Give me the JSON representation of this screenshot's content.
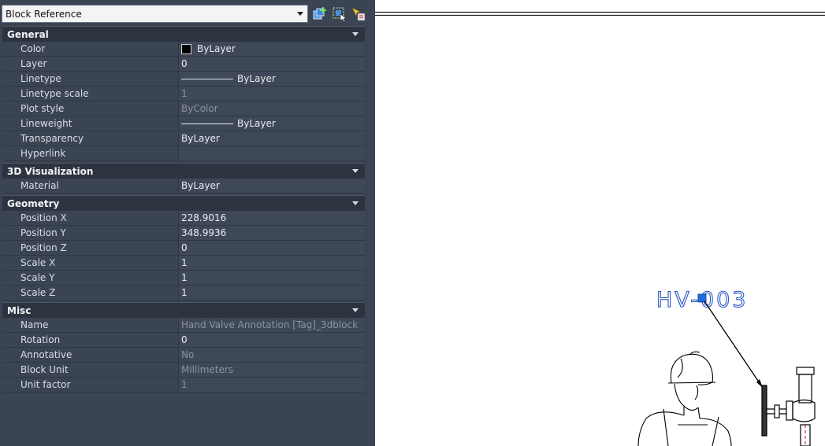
{
  "palette": {
    "selected_object": "Block Reference",
    "icons": {
      "toggle_pickadd": "toggle-pickadd-icon",
      "select_objects": "select-objects-icon",
      "quick_select": "quick-select-icon"
    },
    "categories": [
      {
        "title": "General",
        "rows": [
          {
            "name": "Color",
            "value": "ByLayer",
            "kind": "color",
            "readonly": false
          },
          {
            "name": "Layer",
            "value": "0",
            "kind": "text",
            "readonly": false
          },
          {
            "name": "Linetype",
            "value": "ByLayer",
            "kind": "line",
            "readonly": false
          },
          {
            "name": "Linetype scale",
            "value": "1",
            "kind": "text",
            "readonly": true
          },
          {
            "name": "Plot style",
            "value": "ByColor",
            "kind": "text",
            "readonly": true
          },
          {
            "name": "Lineweight",
            "value": "ByLayer",
            "kind": "line",
            "readonly": false
          },
          {
            "name": "Transparency",
            "value": "ByLayer",
            "kind": "text",
            "readonly": false
          },
          {
            "name": "Hyperlink",
            "value": "",
            "kind": "text",
            "readonly": false
          }
        ]
      },
      {
        "title": "3D Visualization",
        "rows": [
          {
            "name": "Material",
            "value": "ByLayer",
            "kind": "text",
            "readonly": false
          }
        ]
      },
      {
        "title": "Geometry",
        "rows": [
          {
            "name": "Position X",
            "value": "228.9016",
            "kind": "text",
            "readonly": false
          },
          {
            "name": "Position Y",
            "value": "348.9936",
            "kind": "text",
            "readonly": false
          },
          {
            "name": "Position Z",
            "value": "0",
            "kind": "text",
            "readonly": false
          },
          {
            "name": "Scale X",
            "value": "1",
            "kind": "text",
            "readonly": false
          },
          {
            "name": "Scale Y",
            "value": "1",
            "kind": "text",
            "readonly": false
          },
          {
            "name": "Scale Z",
            "value": "1",
            "kind": "text",
            "readonly": false
          }
        ]
      },
      {
        "title": "Misc",
        "rows": [
          {
            "name": "Name",
            "value": "Hand Valve Annotation [Tag]_3dblock",
            "kind": "text",
            "readonly": true
          },
          {
            "name": "Rotation",
            "value": "0",
            "kind": "text",
            "readonly": false
          },
          {
            "name": "Annotative",
            "value": "No",
            "kind": "text",
            "readonly": true
          },
          {
            "name": "Block Unit",
            "value": "Millimeters",
            "kind": "text",
            "readonly": true
          },
          {
            "name": "Unit factor",
            "value": "1",
            "kind": "text",
            "readonly": true
          }
        ]
      }
    ]
  },
  "drawing": {
    "tag_text": "HV-003",
    "tag_color": "#2b59c3",
    "grip_color": "#1f6fe0"
  }
}
